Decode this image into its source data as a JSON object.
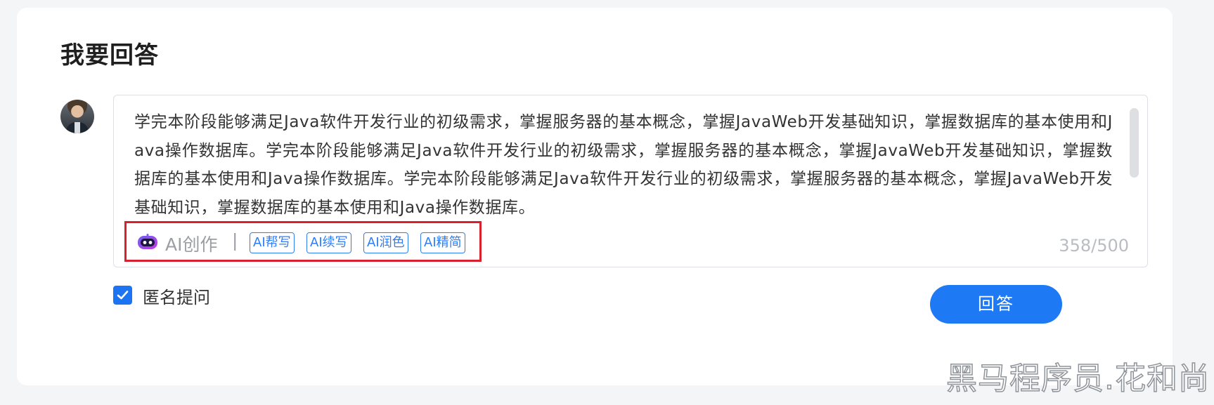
{
  "page": {
    "title": "我要回答"
  },
  "editor": {
    "content": "学完本阶段能够满足Java软件开发行业的初级需求，掌握服务器的基本概念，掌握JavaWeb开发基础知识，掌握数据库的基本使用和Java操作数据库。学完本阶段能够满足Java软件开发行业的初级需求，掌握服务器的基本概念，掌握JavaWeb开发基础知识，掌握数据库的基本使用和Java操作数据库。学完本阶段能够满足Java软件开发行业的初级需求，掌握服务器的基本概念，掌握JavaWeb开发基础知识，掌握数据库的基本使用和Java操作数据库。",
    "counter": "358/500"
  },
  "ai_tools": {
    "label": "AI创作",
    "separator": "|",
    "buttons": [
      "AI帮写",
      "AI续写",
      "AI润色",
      "AI精简"
    ]
  },
  "anonymous": {
    "label": "匿名提问",
    "checked": true
  },
  "submit": {
    "label": "回答"
  },
  "watermark": "黑马程序员.花和尚",
  "colors": {
    "accent": "#1e79f5",
    "highlight_border": "#d6222f",
    "muted_text": "#9b9ea3"
  },
  "icons": {
    "robot": "ai-robot-icon",
    "check": "check-icon"
  }
}
